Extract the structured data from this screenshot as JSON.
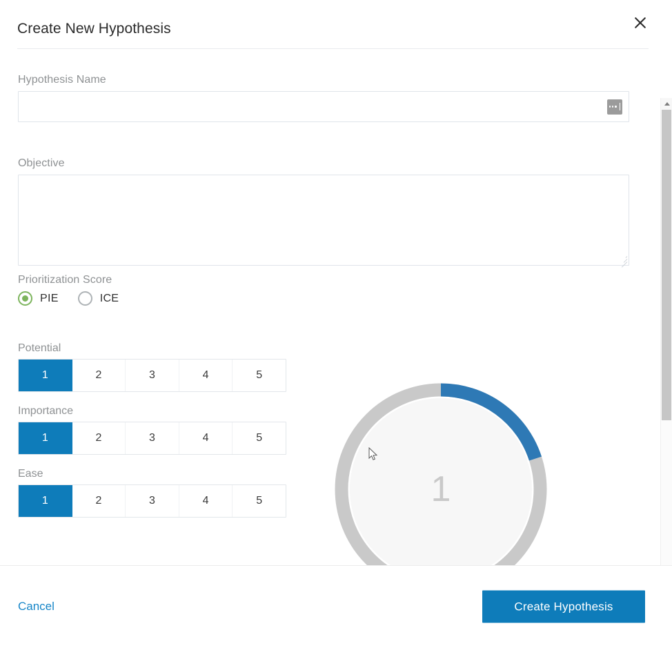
{
  "dialog": {
    "title": "Create New Hypothesis",
    "close_label": "Close"
  },
  "form": {
    "hypothesis_name": {
      "label": "Hypothesis Name",
      "value": "",
      "placeholder": ""
    },
    "objective": {
      "label": "Objective",
      "value": "",
      "placeholder": ""
    },
    "prioritization": {
      "label": "Prioritization Score",
      "options": [
        {
          "label": "PIE",
          "selected": true
        },
        {
          "label": "ICE",
          "selected": false
        }
      ]
    },
    "scores": [
      {
        "label": "Potential",
        "options": [
          "1",
          "2",
          "3",
          "4",
          "5"
        ],
        "selected": "1"
      },
      {
        "label": "Importance",
        "options": [
          "1",
          "2",
          "3",
          "4",
          "5"
        ],
        "selected": "1"
      },
      {
        "label": "Ease",
        "options": [
          "1",
          "2",
          "3",
          "4",
          "5"
        ],
        "selected": "1"
      }
    ]
  },
  "gauge": {
    "value": "1",
    "min": 0,
    "max": 5,
    "percent": 20,
    "arc_color": "#2e79b5",
    "track_color": "#c9c9c9"
  },
  "footer": {
    "cancel_label": "Cancel",
    "submit_label": "Create Hypothesis"
  },
  "colors": {
    "accent_blue": "#0e7cba",
    "link_blue": "#1786c8",
    "radio_green": "#7cb45c",
    "label_gray": "#8e9193"
  },
  "scrollbar": {
    "up_arrow": "scroll-up",
    "down_arrow": "scroll-down",
    "thumb_position_percent": 0
  }
}
